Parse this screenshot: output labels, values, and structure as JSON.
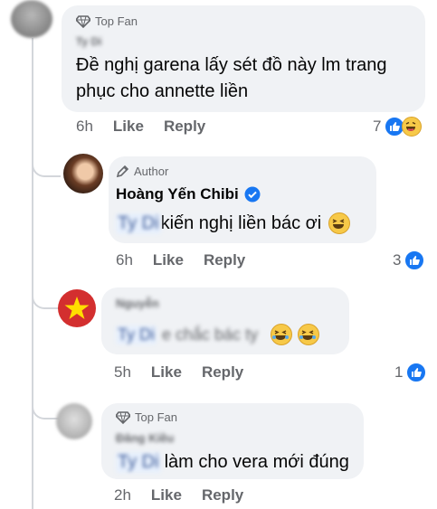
{
  "comments": [
    {
      "badge": "Top Fan",
      "author": "Ty Di",
      "text": "Đề nghị garena lấy sét đồ này lm trang phục cho annette liền",
      "time": "6h",
      "like_label": "Like",
      "reply_label": "Reply",
      "reaction_count": "7"
    },
    {
      "badge": "Author",
      "author": "Hoàng Yến Chibi",
      "tag": "Ty Di",
      "text": "kiến nghị liền bác ơi",
      "time": "6h",
      "like_label": "Like",
      "reply_label": "Reply",
      "reaction_count": "3"
    },
    {
      "author": "Nguyễn",
      "tag": "Ty Di",
      "text": "e chắc bác ty",
      "time": "5h",
      "like_label": "Like",
      "reply_label": "Reply",
      "reaction_count": "1"
    },
    {
      "badge": "Top Fan",
      "author": "Đăng Kiều",
      "tag": "Ty Di",
      "text": "làm cho vera mới đúng",
      "time": "2h",
      "like_label": "Like",
      "reply_label": "Reply"
    }
  ],
  "colors": {
    "bubble": "#f0f2f5",
    "like_blue": "#1877f2",
    "meta_gray": "#65676b",
    "verified_blue": "#1877f2"
  },
  "icons": {
    "top_fan": "diamond-icon",
    "author": "pencil-icon",
    "verified": "verified-badge-icon",
    "like": "like-thumb-icon",
    "haha": "laughing-emoji-icon"
  }
}
